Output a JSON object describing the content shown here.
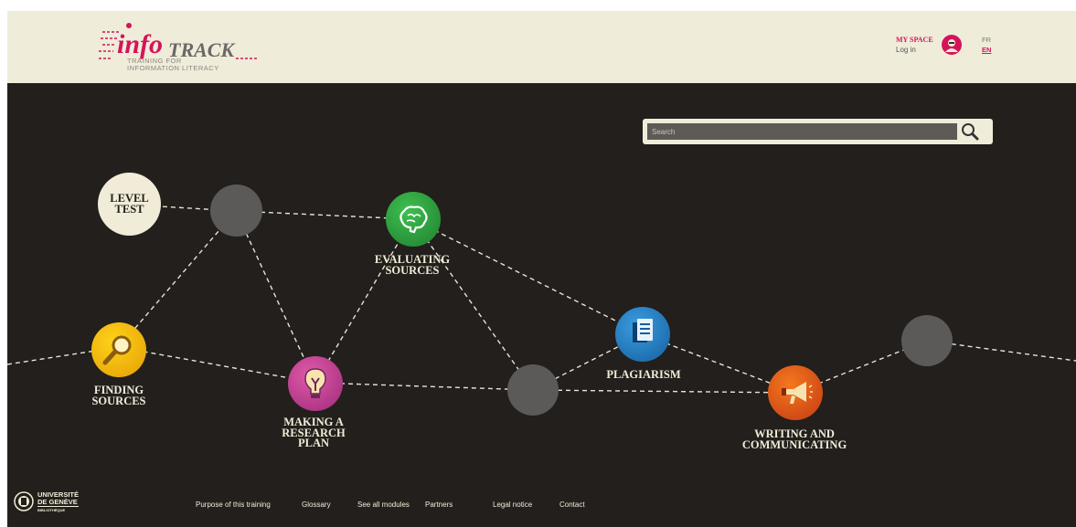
{
  "header": {
    "logo_info": "info",
    "logo_track": "TRACK",
    "logo_subtitle_line1": "TRAINING FOR",
    "logo_subtitle_line2": "INFORMATION LITERACY",
    "myspace_title": "MY SPACE",
    "login_label": "Log in",
    "lang_fr": "FR",
    "lang_en": "EN"
  },
  "search": {
    "placeholder": "Search"
  },
  "modules": {
    "level_test_line1": "LEVEL",
    "level_test_line2": "TEST",
    "evaluating_line1": "EVALUATING",
    "evaluating_line2": "SOURCES",
    "finding_line1": "FINDING",
    "finding_line2": "SOURCES",
    "making_line1": "MAKING A",
    "making_line2": "RESEARCH",
    "making_line3": "PLAN",
    "plagiarism": "PLAGIARISM",
    "writing_line1": "WRITING AND",
    "writing_line2": "COMMUNICATING"
  },
  "footer": {
    "univ_line1": "UNIVERSITÉ",
    "univ_line2": "DE GENÈVE",
    "univ_line3": "BIBLIOTHÈQUE",
    "links": [
      "Purpose of this training",
      "Glossary",
      "See all modules",
      "Partners",
      "Legal notice",
      "Contact"
    ]
  },
  "colors": {
    "brand": "#d4145a",
    "background": "#221f1c",
    "header_bg": "#efecd9",
    "evaluating": "#2a9a3b",
    "finding": "#f2b705",
    "making": "#c43a8f",
    "plagiarism": "#1f7fc4",
    "writing": "#e8541e",
    "placeholder_node": "#5c5a58"
  },
  "icons": [
    "magnifier-icon",
    "brain-icon",
    "lightbulb-icon",
    "document-icon",
    "megaphone-icon",
    "avatar-icon",
    "search-icon",
    "university-seal-icon"
  ]
}
